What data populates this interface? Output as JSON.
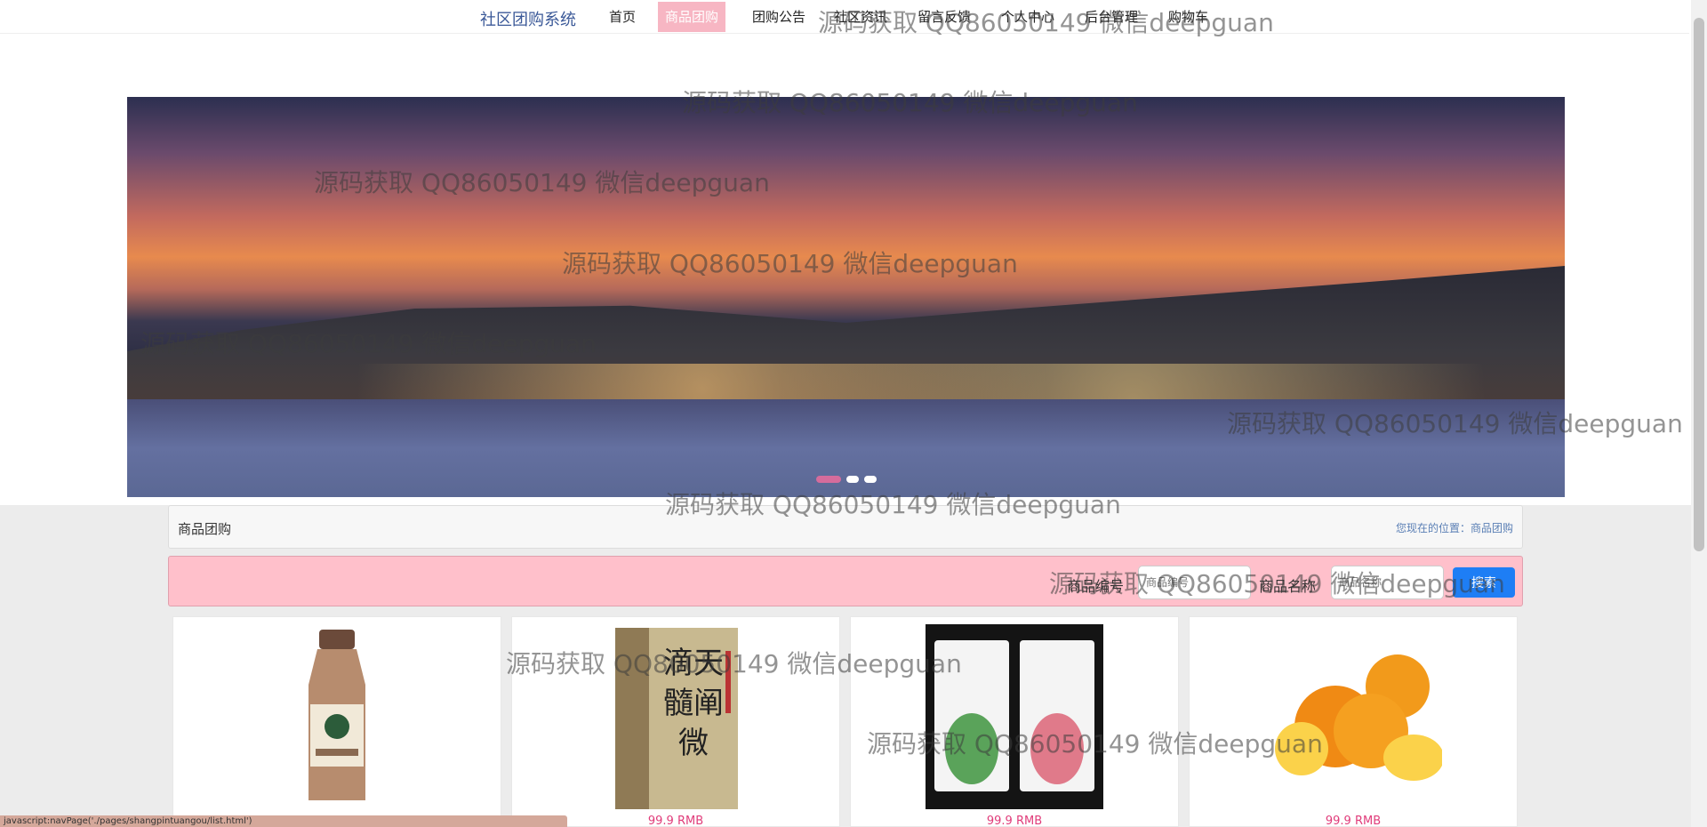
{
  "brand": "社区团购系统",
  "nav": [
    {
      "label": "首页"
    },
    {
      "label": "商品团购",
      "active": true
    },
    {
      "label": "团购公告"
    },
    {
      "label": "社区资讯"
    },
    {
      "label": "留言反馈"
    },
    {
      "label": "个人中心"
    },
    {
      "label": "后台管理"
    },
    {
      "label": "购物车"
    }
  ],
  "banner": {
    "slides": 3,
    "active_slide": 1
  },
  "breadcrumb": {
    "title": "商品团购",
    "location": "您现在的位置：商品团购"
  },
  "search": {
    "code_label": "商品编号",
    "code_placeholder": "商品编号",
    "name_label": "商品名称",
    "name_placeholder": "商品名称",
    "button": "搜索"
  },
  "products": [
    {
      "image": "milk-tea-bottle",
      "price": ""
    },
    {
      "image": "book-box",
      "price": "99.9 RMB"
    },
    {
      "image": "face-mask-pack",
      "price": "99.9 RMB"
    },
    {
      "image": "oranges",
      "price": "99.9 RMB"
    }
  ],
  "status_url": "javascript:navPage('./pages/shangpintuangou/list.html')",
  "watermark": "源码获取 QQ86050149 微信deepguan",
  "colors": {
    "accent_pink": "#ffc0cb",
    "nav_active": "#f7b6c3",
    "button_blue": "#1e7ef5",
    "price": "#e03c7a"
  }
}
